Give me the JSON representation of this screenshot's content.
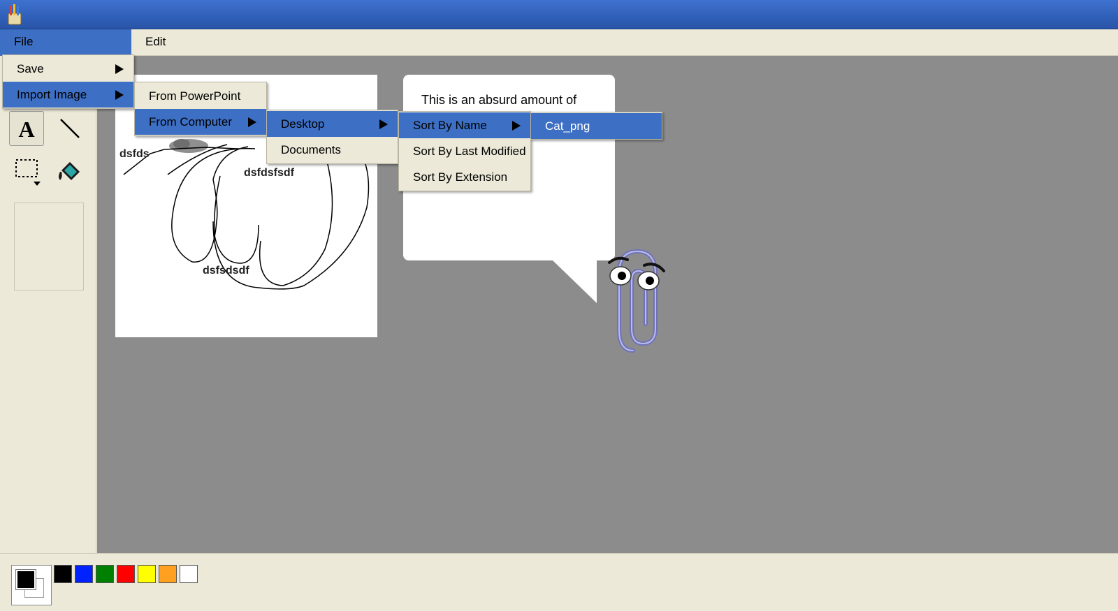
{
  "menubar": {
    "file": "File",
    "edit": "Edit"
  },
  "file_menu": {
    "save": "Save",
    "import_image": "Import Image"
  },
  "import_menu": {
    "from_powerpoint": "From PowerPoint",
    "from_computer": "From Computer"
  },
  "computer_menu": {
    "desktop": "Desktop",
    "documents": "Documents"
  },
  "sort_menu": {
    "by_name": "Sort By Name",
    "by_last_modified": "Sort By Last Modified",
    "by_extension": "Sort By Extension"
  },
  "files_menu": {
    "cat": "Cat_png"
  },
  "canvas": {
    "text1": "dsfds",
    "text2": "dsfdsfsdf",
    "text3": "dsfsdsdf"
  },
  "bubble": {
    "text": "This is an absurd amount of"
  },
  "palette": {
    "current_fg": "#000000",
    "colors": [
      "#000000",
      "#0022ff",
      "#008000",
      "#ff0000",
      "#ffff00",
      "#ffa020",
      "#ffffff"
    ]
  },
  "colors": {
    "title_bar": "#2f5fb8",
    "menu_highlight": "#3d6fc4",
    "workspace": "#8c8c8c"
  }
}
